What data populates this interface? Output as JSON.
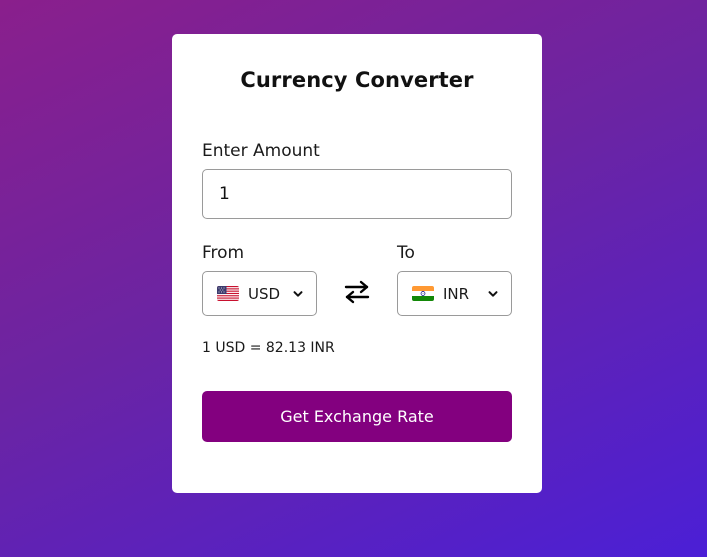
{
  "card": {
    "title": "Currency Converter"
  },
  "amount": {
    "label": "Enter Amount",
    "value": "1"
  },
  "from": {
    "label": "From",
    "currency": "USD",
    "flag_icon": "us-flag-icon"
  },
  "to": {
    "label": "To",
    "currency": "INR",
    "flag_icon": "india-flag-icon"
  },
  "swap_icon": "swap-arrows-icon",
  "exchange_text": "1 USD = 82.13 INR",
  "button": {
    "label": "Get Exchange Rate"
  },
  "colors": {
    "button_bg": "#83007f",
    "background_start": "#8a1f8c",
    "background_end": "#4b1fd6"
  }
}
